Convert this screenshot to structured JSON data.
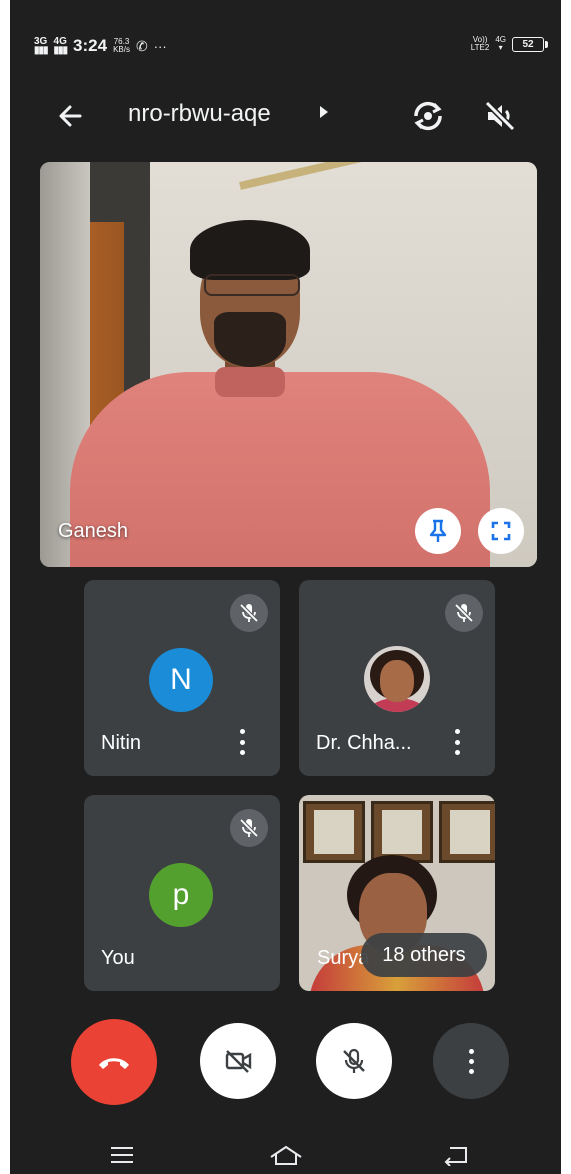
{
  "status_bar": {
    "network_left_1": "3G",
    "network_left_2": "4G",
    "time": "3:24",
    "speed_value": "76.3",
    "speed_unit": "KB/s",
    "more": "···",
    "volte": "Vo))",
    "lte": "LTE2",
    "network_right": "4G",
    "battery": "52"
  },
  "app_bar": {
    "meeting_code": "nro-rbwu-aqe"
  },
  "main_tile": {
    "participant_name": "Ganesh"
  },
  "participants": [
    {
      "name": "Nitin",
      "avatar_letter": "N",
      "avatar_color": "#1a8cd8"
    },
    {
      "name": "Dr. Chha..."
    },
    {
      "name": "You",
      "avatar_letter": "p",
      "avatar_color": "#53a02f"
    },
    {
      "name": "Surya",
      "others_label": "18 others"
    }
  ],
  "colors": {
    "end_call": "#ea4335",
    "tile_bg": "#3c4043",
    "app_bg": "#1f1f1f"
  },
  "icons": {
    "back": "arrow-left-icon",
    "switch_camera": "camera-switch-icon",
    "speaker": "speaker-off-icon",
    "pin": "pin-icon",
    "fullscreen": "fullscreen-icon",
    "mic_off": "mic-off-icon",
    "end_call": "phone-hangup-icon",
    "camera_off": "camera-off-icon",
    "more": "more-vert-icon"
  }
}
